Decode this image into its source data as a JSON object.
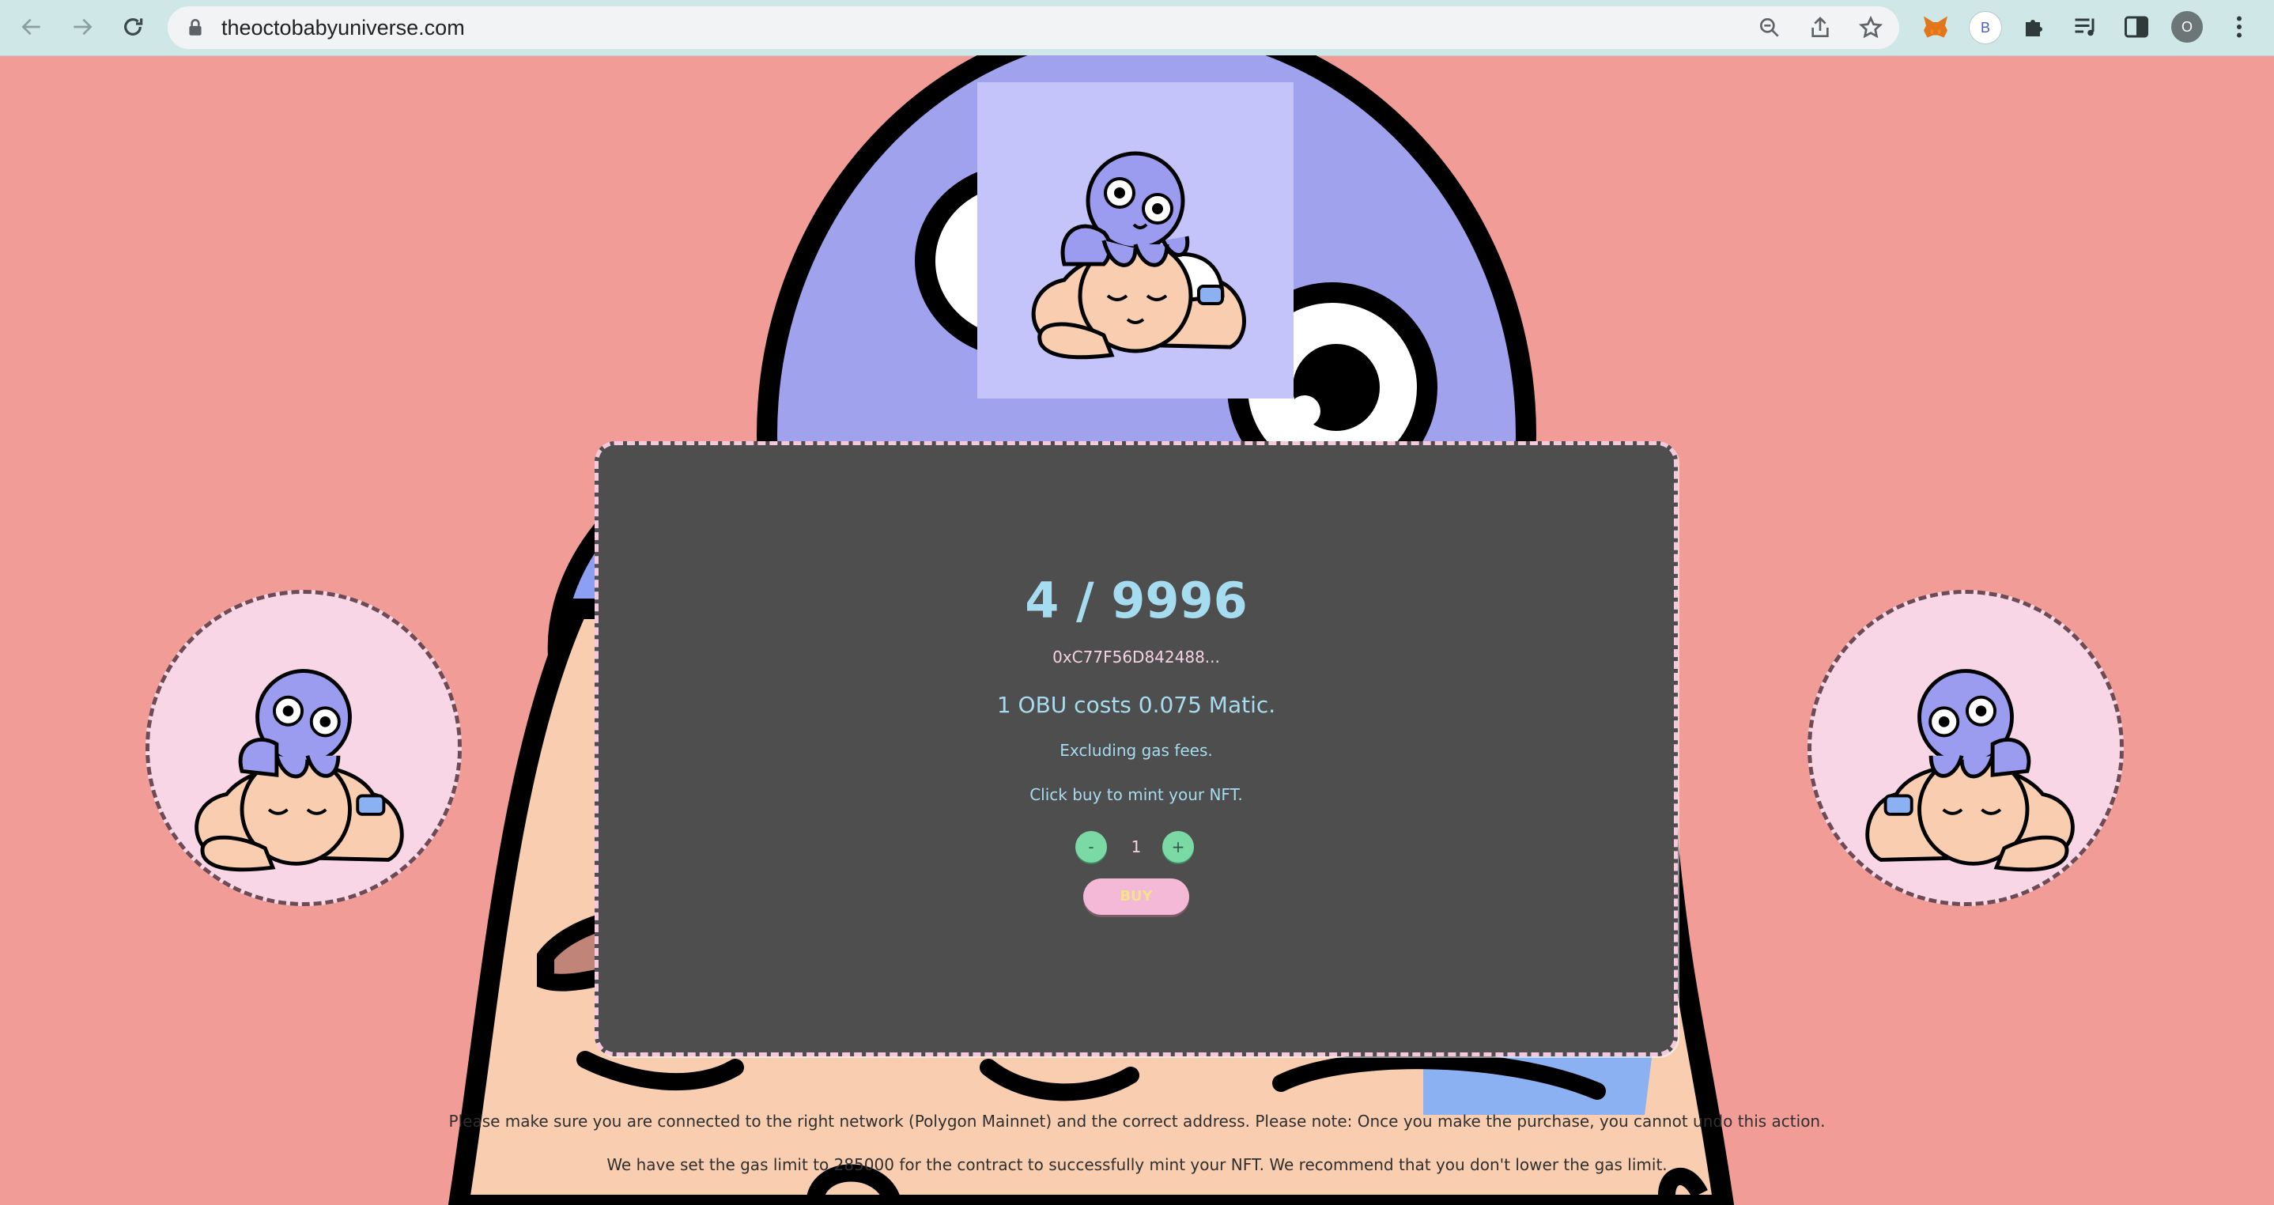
{
  "browser": {
    "url": "theoctobabyuniverse.com",
    "profile_initial": "O",
    "extension_initial": "B"
  },
  "mint": {
    "counter": "4 / 9996",
    "wallet_address": "0xC77F56D842488...",
    "cost_text": "1 OBU costs 0.075 Matic.",
    "gas_note": "Excluding gas fees.",
    "instruction": "Click buy to mint your NFT.",
    "minus_label": "-",
    "plus_label": "+",
    "quantity": "1",
    "buy_label": "BUY"
  },
  "footer": {
    "network_notice": "Please make sure you are connected to the right network (Polygon Mainnet) and the correct address. Please note: Once you make the purchase, you cannot undo this action.",
    "gas_notice": "We have set the gas limit to 285000 for the contract to successfully mint your NFT. We recommend that you don't lower the gas limit."
  },
  "colors": {
    "page_bg": "#f29c98",
    "panel_bg": "#4e4e4e",
    "counter": "#a6dcef",
    "octopus": "#9b9bf0",
    "buy_button": "#f4b9d7",
    "qty_button": "#7ad9a5"
  }
}
